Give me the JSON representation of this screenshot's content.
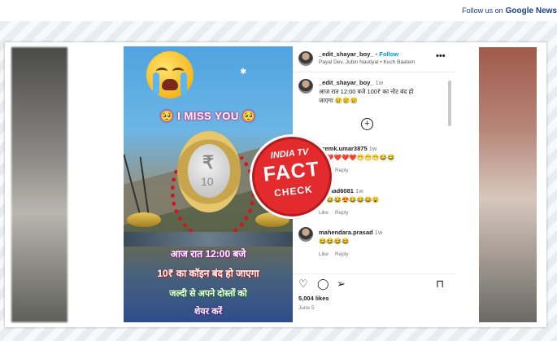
{
  "header": {
    "follow_text": "Follow us on",
    "google_text": "Google News"
  },
  "post_image": {
    "miss_you": "🥺 I MISS YOU 🥺",
    "line1": "आज रात 12:00 बजे",
    "line2": "10₹ का कॉइन बंद हो जाएगा",
    "line3": "जल्दी से अपने दोस्तों को",
    "line4": "शेयर करें",
    "coin_symbol": "₹",
    "coin_value": "10"
  },
  "fact_badge": {
    "brand": "INDIA TV",
    "word1": "FACT",
    "word2": "CHECK",
    "color": "#e32b2e"
  },
  "instagram": {
    "author": "_edit_shayar_boy_",
    "separator": "•",
    "follow": "Follow",
    "audio": "Payal Dev, Jubin Nautiyal • Kuch Baatein",
    "more_icon": "more-horizontal-icon",
    "caption_author": "_edit_shayar_boy_",
    "caption_time": "1w",
    "caption_line1": "आज रात 12:00 बजे 100₹ का नोट बंद हो",
    "caption_line2": "जाएगा 😢😢😢",
    "add_icon": "plus-circle-icon",
    "comments": [
      {
        "user": "premk.umar3875",
        "time": "1w",
        "text": "❤️❤️❤️❤️❤️😁😁😁😂😂",
        "reply": "Reply"
      },
      {
        "user": "mishad6081",
        "time": "1w",
        "text": "😂😂😂😍😂😂😂😮",
        "reply": "Reply"
      },
      {
        "user": "mahendara.prasad",
        "time": "1w",
        "text": "😂😂😂😂",
        "reply": "Reply"
      }
    ],
    "comment_like": "Like",
    "likes": "5,004 likes",
    "date": "June 5"
  }
}
